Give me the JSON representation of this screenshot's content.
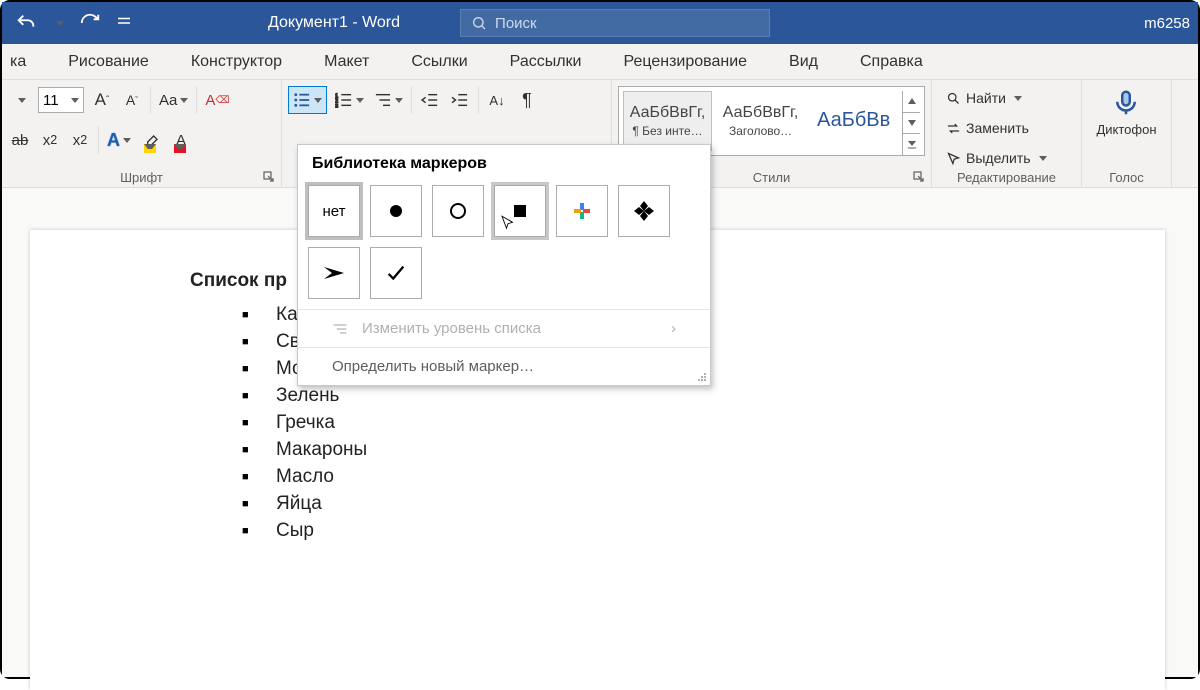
{
  "titlebar": {
    "doc_title": "Документ1 - Word",
    "search_placeholder": "Поиск",
    "user": "m6258"
  },
  "tabs": {
    "t0": "ка",
    "t1": "Рисование",
    "t2": "Конструктор",
    "t3": "Макет",
    "t4": "Ссылки",
    "t5": "Рассылки",
    "t6": "Рецензирование",
    "t7": "Вид",
    "t8": "Справка"
  },
  "font": {
    "size": "11",
    "group_label": "Шрифт"
  },
  "styles": {
    "s1_sample": "АаБбВвГг,",
    "s1_name": "¶ Без инте…",
    "s2_sample": "АаБбВвГг,",
    "s2_name": "Заголово…",
    "s3_sample": "АаБбВв",
    "group_label": "Стили"
  },
  "editing": {
    "find": "Найти",
    "replace": "Заменить",
    "select": "Выделить",
    "group_label": "Редактирование"
  },
  "voice": {
    "dictate": "Диктофон",
    "group_label": "Голос"
  },
  "bullet_popup": {
    "title": "Библиотека маркеров",
    "none": "нет",
    "change_level": "Изменить уровень списка",
    "define_new": "Определить новый маркер…"
  },
  "document": {
    "heading": "Список пр",
    "items": [
      "Картофель",
      "Свекла",
      "Морковь",
      "Зелень",
      "Гречка",
      "Макароны",
      "Масло",
      "Яйца",
      "Сыр"
    ]
  }
}
